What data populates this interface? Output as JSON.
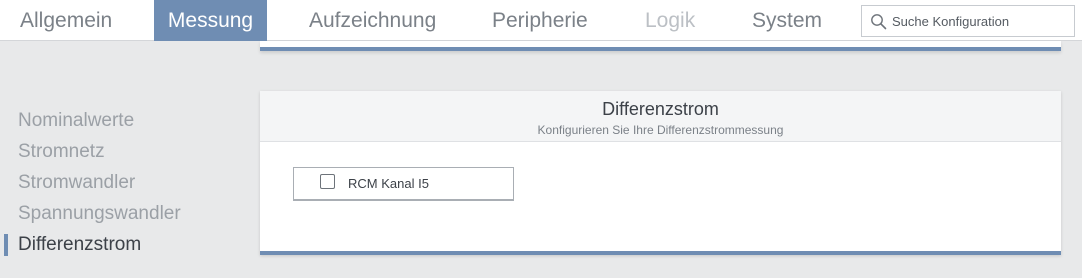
{
  "nav": {
    "tabs": [
      {
        "label": "Allgemein",
        "state": "normal"
      },
      {
        "label": "Messung",
        "state": "active"
      },
      {
        "label": "Aufzeichnung",
        "state": "normal"
      },
      {
        "label": "Peripherie",
        "state": "normal"
      },
      {
        "label": "Logik",
        "state": "disabled"
      },
      {
        "label": "System",
        "state": "normal"
      }
    ],
    "search": {
      "placeholder": "Suche Konfiguration",
      "icon": "search-icon"
    }
  },
  "sidebar": {
    "items": [
      {
        "label": "Nominalwerte",
        "active": false
      },
      {
        "label": "Stromnetz",
        "active": false
      },
      {
        "label": "Stromwandler",
        "active": false
      },
      {
        "label": "Spannungswandler",
        "active": false
      },
      {
        "label": "Differenzstrom",
        "active": true
      }
    ]
  },
  "card": {
    "title": "Differenzstrom",
    "subtitle": "Konfigurieren Sie Ihre Differenzstrommessung",
    "option": {
      "label": "RCM Kanal I5",
      "checked": false
    }
  },
  "colors": {
    "accent": "#6f8db3",
    "background": "#e8e9ea",
    "text_dark": "#3c4148",
    "text_muted": "#9ba0a6"
  }
}
